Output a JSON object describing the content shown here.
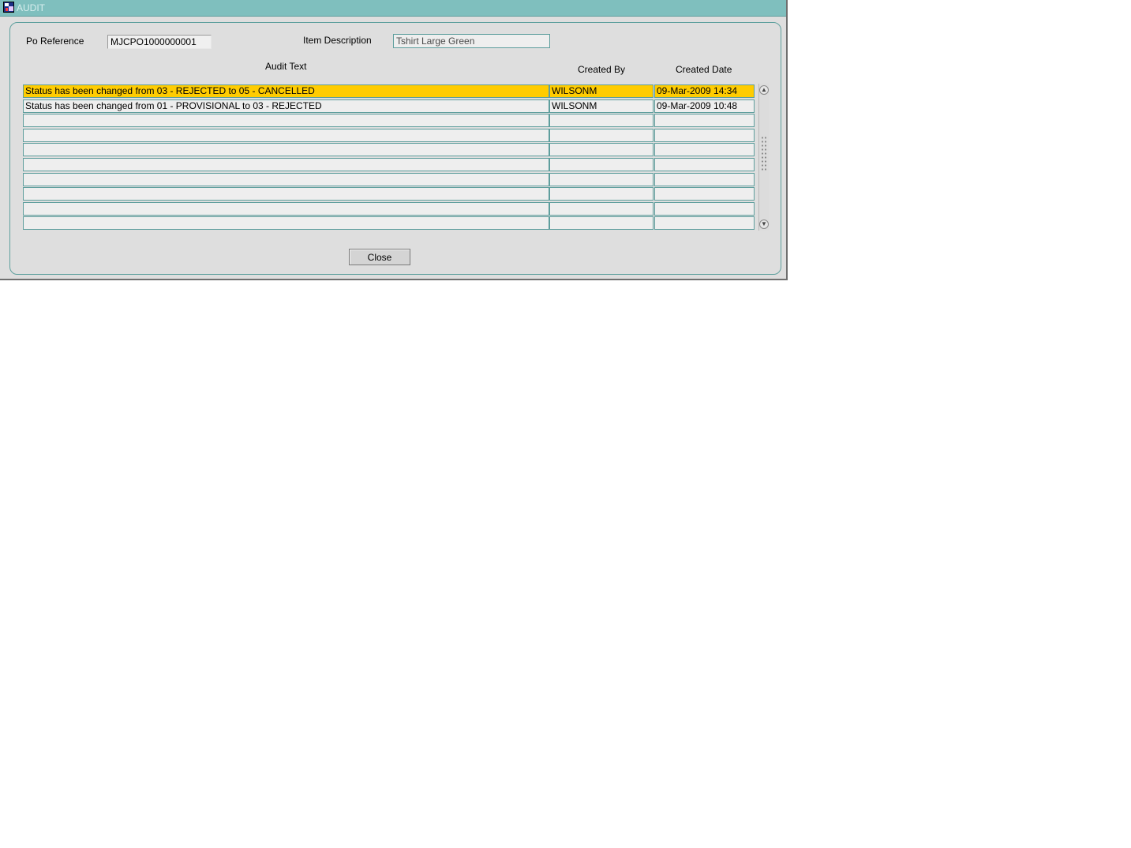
{
  "window": {
    "title": "AUDIT"
  },
  "form": {
    "po_reference_label": "Po Reference",
    "po_reference_value": "MJCPO1000000001",
    "item_description_label": "Item Description",
    "item_description_value": "Tshirt Large Green"
  },
  "table": {
    "headers": {
      "audit_text": "Audit Text",
      "created_by": "Created By",
      "created_date": "Created Date"
    },
    "selected_row": 0,
    "rows": [
      {
        "audit_text": "Status has been changed from 03 - REJECTED to 05 - CANCELLED",
        "created_by": "WILSONM",
        "created_date": "09-Mar-2009 14:34"
      },
      {
        "audit_text": "Status has been changed from 01 - PROVISIONAL to 03 - REJECTED",
        "created_by": "WILSONM",
        "created_date": "09-Mar-2009 10:48"
      },
      {
        "audit_text": "",
        "created_by": "",
        "created_date": ""
      },
      {
        "audit_text": "",
        "created_by": "",
        "created_date": ""
      },
      {
        "audit_text": "",
        "created_by": "",
        "created_date": ""
      },
      {
        "audit_text": "",
        "created_by": "",
        "created_date": ""
      },
      {
        "audit_text": "",
        "created_by": "",
        "created_date": ""
      },
      {
        "audit_text": "",
        "created_by": "",
        "created_date": ""
      },
      {
        "audit_text": "",
        "created_by": "",
        "created_date": ""
      },
      {
        "audit_text": "",
        "created_by": "",
        "created_date": ""
      }
    ]
  },
  "buttons": {
    "close": "Close"
  },
  "colors": {
    "titlebar": "#7fbfbe",
    "selection": "#ffcc00",
    "field_border": "#5e9e9d"
  },
  "icons": {
    "app": "app-icon",
    "scroll_up": "scroll-up-arrow-icon",
    "scroll_down": "scroll-down-arrow-icon"
  }
}
